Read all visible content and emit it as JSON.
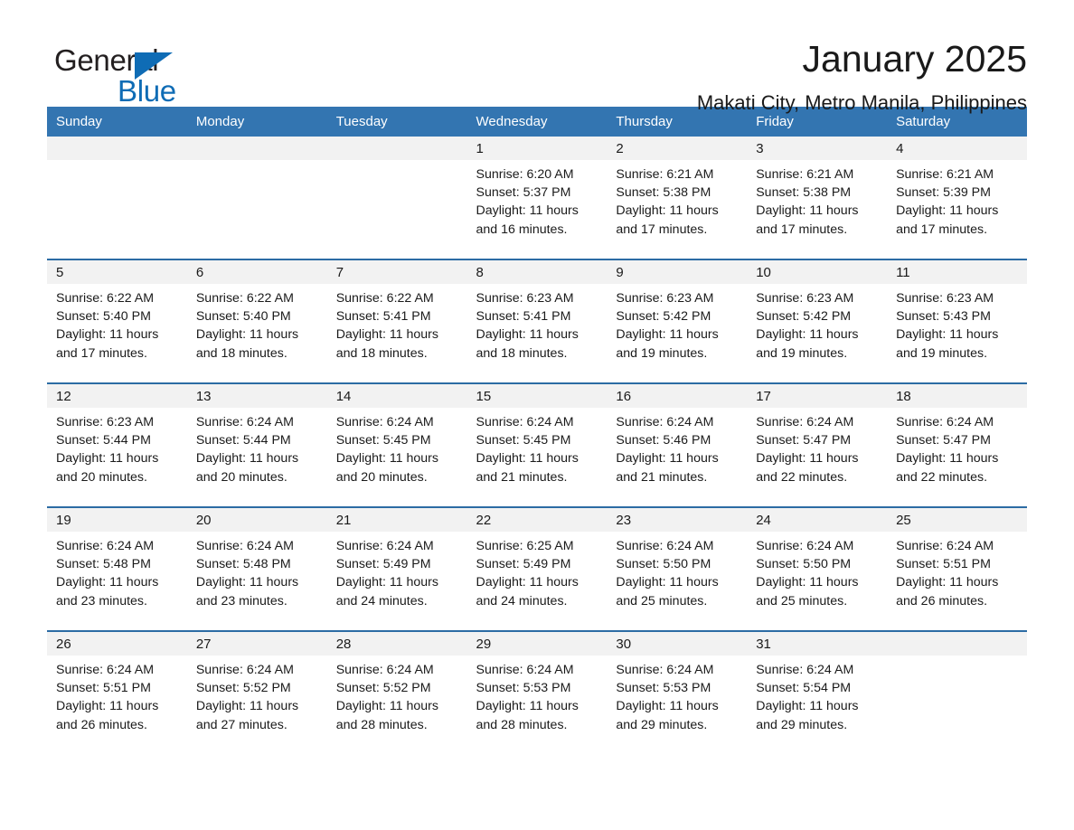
{
  "brand": {
    "name_part1": "General",
    "name_part2": "Blue",
    "accent_color": "#0f6cb5"
  },
  "header": {
    "month_title": "January 2025",
    "location": "Makati City, Metro Manila, Philippines",
    "header_bg_color": "#3375b1",
    "row_divider_color": "#2c6ca4",
    "daynum_band_color": "#f2f2f2"
  },
  "weekdays": [
    "Sunday",
    "Monday",
    "Tuesday",
    "Wednesday",
    "Thursday",
    "Friday",
    "Saturday"
  ],
  "labels": {
    "sunrise_prefix": "Sunrise:",
    "sunset_prefix": "Sunset:",
    "daylight_prefix": "Daylight:"
  },
  "weeks": [
    [
      {
        "day": "",
        "sunrise": "",
        "sunset": "",
        "daylight": "",
        "empty": true
      },
      {
        "day": "",
        "sunrise": "",
        "sunset": "",
        "daylight": "",
        "empty": true
      },
      {
        "day": "",
        "sunrise": "",
        "sunset": "",
        "daylight": "",
        "empty": true
      },
      {
        "day": "1",
        "sunrise": "Sunrise: 6:20 AM",
        "sunset": "Sunset: 5:37 PM",
        "daylight": "Daylight: 11 hours and 16 minutes.",
        "empty": false
      },
      {
        "day": "2",
        "sunrise": "Sunrise: 6:21 AM",
        "sunset": "Sunset: 5:38 PM",
        "daylight": "Daylight: 11 hours and 17 minutes.",
        "empty": false
      },
      {
        "day": "3",
        "sunrise": "Sunrise: 6:21 AM",
        "sunset": "Sunset: 5:38 PM",
        "daylight": "Daylight: 11 hours and 17 minutes.",
        "empty": false
      },
      {
        "day": "4",
        "sunrise": "Sunrise: 6:21 AM",
        "sunset": "Sunset: 5:39 PM",
        "daylight": "Daylight: 11 hours and 17 minutes.",
        "empty": false
      }
    ],
    [
      {
        "day": "5",
        "sunrise": "Sunrise: 6:22 AM",
        "sunset": "Sunset: 5:40 PM",
        "daylight": "Daylight: 11 hours and 17 minutes.",
        "empty": false
      },
      {
        "day": "6",
        "sunrise": "Sunrise: 6:22 AM",
        "sunset": "Sunset: 5:40 PM",
        "daylight": "Daylight: 11 hours and 18 minutes.",
        "empty": false
      },
      {
        "day": "7",
        "sunrise": "Sunrise: 6:22 AM",
        "sunset": "Sunset: 5:41 PM",
        "daylight": "Daylight: 11 hours and 18 minutes.",
        "empty": false
      },
      {
        "day": "8",
        "sunrise": "Sunrise: 6:23 AM",
        "sunset": "Sunset: 5:41 PM",
        "daylight": "Daylight: 11 hours and 18 minutes.",
        "empty": false
      },
      {
        "day": "9",
        "sunrise": "Sunrise: 6:23 AM",
        "sunset": "Sunset: 5:42 PM",
        "daylight": "Daylight: 11 hours and 19 minutes.",
        "empty": false
      },
      {
        "day": "10",
        "sunrise": "Sunrise: 6:23 AM",
        "sunset": "Sunset: 5:42 PM",
        "daylight": "Daylight: 11 hours and 19 minutes.",
        "empty": false
      },
      {
        "day": "11",
        "sunrise": "Sunrise: 6:23 AM",
        "sunset": "Sunset: 5:43 PM",
        "daylight": "Daylight: 11 hours and 19 minutes.",
        "empty": false
      }
    ],
    [
      {
        "day": "12",
        "sunrise": "Sunrise: 6:23 AM",
        "sunset": "Sunset: 5:44 PM",
        "daylight": "Daylight: 11 hours and 20 minutes.",
        "empty": false
      },
      {
        "day": "13",
        "sunrise": "Sunrise: 6:24 AM",
        "sunset": "Sunset: 5:44 PM",
        "daylight": "Daylight: 11 hours and 20 minutes.",
        "empty": false
      },
      {
        "day": "14",
        "sunrise": "Sunrise: 6:24 AM",
        "sunset": "Sunset: 5:45 PM",
        "daylight": "Daylight: 11 hours and 20 minutes.",
        "empty": false
      },
      {
        "day": "15",
        "sunrise": "Sunrise: 6:24 AM",
        "sunset": "Sunset: 5:45 PM",
        "daylight": "Daylight: 11 hours and 21 minutes.",
        "empty": false
      },
      {
        "day": "16",
        "sunrise": "Sunrise: 6:24 AM",
        "sunset": "Sunset: 5:46 PM",
        "daylight": "Daylight: 11 hours and 21 minutes.",
        "empty": false
      },
      {
        "day": "17",
        "sunrise": "Sunrise: 6:24 AM",
        "sunset": "Sunset: 5:47 PM",
        "daylight": "Daylight: 11 hours and 22 minutes.",
        "empty": false
      },
      {
        "day": "18",
        "sunrise": "Sunrise: 6:24 AM",
        "sunset": "Sunset: 5:47 PM",
        "daylight": "Daylight: 11 hours and 22 minutes.",
        "empty": false
      }
    ],
    [
      {
        "day": "19",
        "sunrise": "Sunrise: 6:24 AM",
        "sunset": "Sunset: 5:48 PM",
        "daylight": "Daylight: 11 hours and 23 minutes.",
        "empty": false
      },
      {
        "day": "20",
        "sunrise": "Sunrise: 6:24 AM",
        "sunset": "Sunset: 5:48 PM",
        "daylight": "Daylight: 11 hours and 23 minutes.",
        "empty": false
      },
      {
        "day": "21",
        "sunrise": "Sunrise: 6:24 AM",
        "sunset": "Sunset: 5:49 PM",
        "daylight": "Daylight: 11 hours and 24 minutes.",
        "empty": false
      },
      {
        "day": "22",
        "sunrise": "Sunrise: 6:25 AM",
        "sunset": "Sunset: 5:49 PM",
        "daylight": "Daylight: 11 hours and 24 minutes.",
        "empty": false
      },
      {
        "day": "23",
        "sunrise": "Sunrise: 6:24 AM",
        "sunset": "Sunset: 5:50 PM",
        "daylight": "Daylight: 11 hours and 25 minutes.",
        "empty": false
      },
      {
        "day": "24",
        "sunrise": "Sunrise: 6:24 AM",
        "sunset": "Sunset: 5:50 PM",
        "daylight": "Daylight: 11 hours and 25 minutes.",
        "empty": false
      },
      {
        "day": "25",
        "sunrise": "Sunrise: 6:24 AM",
        "sunset": "Sunset: 5:51 PM",
        "daylight": "Daylight: 11 hours and 26 minutes.",
        "empty": false
      }
    ],
    [
      {
        "day": "26",
        "sunrise": "Sunrise: 6:24 AM",
        "sunset": "Sunset: 5:51 PM",
        "daylight": "Daylight: 11 hours and 26 minutes.",
        "empty": false
      },
      {
        "day": "27",
        "sunrise": "Sunrise: 6:24 AM",
        "sunset": "Sunset: 5:52 PM",
        "daylight": "Daylight: 11 hours and 27 minutes.",
        "empty": false
      },
      {
        "day": "28",
        "sunrise": "Sunrise: 6:24 AM",
        "sunset": "Sunset: 5:52 PM",
        "daylight": "Daylight: 11 hours and 28 minutes.",
        "empty": false
      },
      {
        "day": "29",
        "sunrise": "Sunrise: 6:24 AM",
        "sunset": "Sunset: 5:53 PM",
        "daylight": "Daylight: 11 hours and 28 minutes.",
        "empty": false
      },
      {
        "day": "30",
        "sunrise": "Sunrise: 6:24 AM",
        "sunset": "Sunset: 5:53 PM",
        "daylight": "Daylight: 11 hours and 29 minutes.",
        "empty": false
      },
      {
        "day": "31",
        "sunrise": "Sunrise: 6:24 AM",
        "sunset": "Sunset: 5:54 PM",
        "daylight": "Daylight: 11 hours and 29 minutes.",
        "empty": false
      },
      {
        "day": "",
        "sunrise": "",
        "sunset": "",
        "daylight": "",
        "empty": true
      }
    ]
  ]
}
